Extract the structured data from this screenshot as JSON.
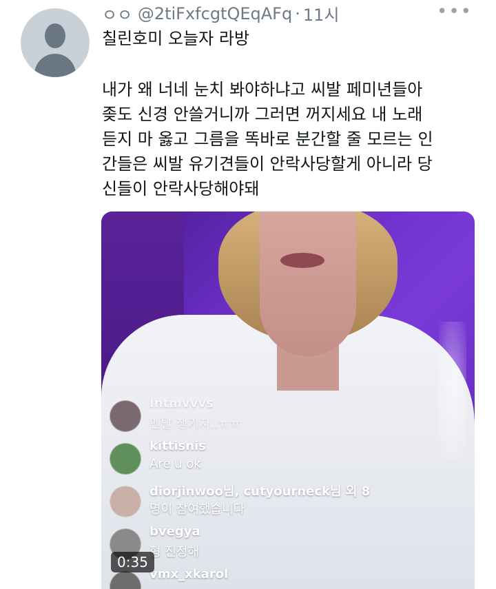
{
  "tweet": {
    "handle_prefix": "ㅇㅇ",
    "handle": "@2tiFxfcgtQEqAFq",
    "separator": "·",
    "time": "11시",
    "more_icon": "more-dots-icon",
    "subtitle": "칠린호미 오늘자 라방",
    "body_lines": [
      "내가 왜 너네 눈치 봐야하냐고 씨발 페미년들아",
      "좆도 신경 안쓸거니까 그러면 꺼지세요 내 노래",
      "듣지 마 옳고 그름을 똑바로 분간할 줄 모르는 인",
      "간들은 씨발 유기견들이 안락사당할게 아니라 당",
      "신들이 안락사당해야돼"
    ]
  },
  "video": {
    "duration": "0:35",
    "comments": [
      {
        "user": "Intmvvvs",
        "message": "멘탈 챙기자..ㅠㅠ"
      },
      {
        "user": "kittisnis",
        "message": "Are u ok"
      },
      {
        "user": "diorjinwoo님, cutyourneck님 외 8",
        "message": "명이 참여했습니다"
      },
      {
        "user": "bvegya",
        "message": "형 진정해"
      },
      {
        "user": "vmx_xkarol",
        "message": ""
      }
    ]
  },
  "colors": {
    "video_bg": "#6a2ec5",
    "text": "#0f1419",
    "muted": "#6e7a86"
  }
}
